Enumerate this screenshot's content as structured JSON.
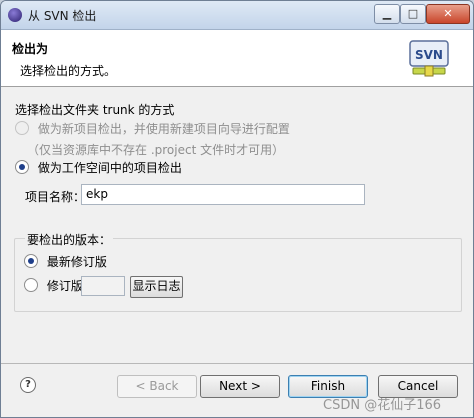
{
  "window": {
    "title": "从 SVN 检出",
    "min_glyph": "▁",
    "max_glyph": "□",
    "close_glyph": "✕"
  },
  "header": {
    "title": "检出为",
    "description": "选择检出的方式。",
    "logo_text": "SVN"
  },
  "checkout_method": {
    "label": "选择检出文件夹 trunk 的方式",
    "option_new_project": "做为新项目检出，并使用新建项目向导进行配置",
    "option_new_project_note": "（仅当资源库中不存在 .project 文件时才可用）",
    "option_workspace": "做为工作空间中的项目检出",
    "selected": "option_workspace"
  },
  "project_name": {
    "label": "项目名称：",
    "value": "ekp"
  },
  "version": {
    "label": "要检出的版本：",
    "option_latest": "最新修订版",
    "option_revision": "修订版",
    "revision_value": "",
    "show_log_button": "显示日志",
    "selected": "option_latest"
  },
  "buttons": {
    "help": "?",
    "back": "< Back",
    "next": "Next >",
    "finish": "Finish",
    "cancel": "Cancel"
  },
  "watermark": "CSDN @花仙子166",
  "colors": {
    "accent": "#1f3f8a",
    "default_button_border": "#3c7fb1"
  },
  "icons": [
    "eclipse-app-icon",
    "svn-logo-icon",
    "help-icon"
  ]
}
